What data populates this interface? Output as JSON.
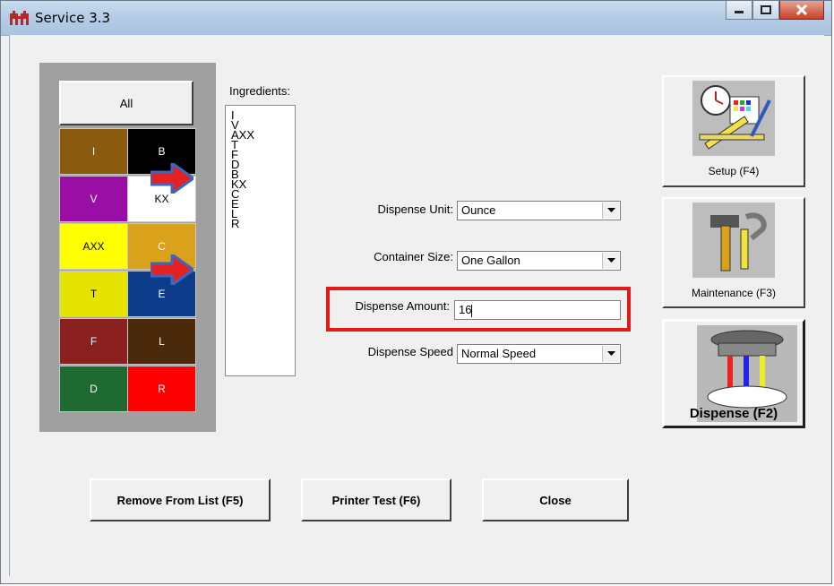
{
  "window": {
    "title": "Service 3.3",
    "controls": [
      "minimize-icon",
      "maximize-icon",
      "close-icon"
    ]
  },
  "palette": {
    "all_label": "All",
    "cells": [
      {
        "label": "I",
        "color": "#8a5a0e",
        "text_color": "#ffffff"
      },
      {
        "label": "B",
        "color": "#000000",
        "text_color": "#ffffff"
      },
      {
        "label": "V",
        "color": "#9a0ea6",
        "text_color": "#ffffff"
      },
      {
        "label": "KX",
        "color": "#ffffff",
        "text_color": "#000000"
      },
      {
        "label": "AXX",
        "color": "#ffff00",
        "text_color": "#000000"
      },
      {
        "label": "C",
        "color": "#d9a21a",
        "text_color": "#ffffff"
      },
      {
        "label": "T",
        "color": "#e4e400",
        "text_color": "#000000"
      },
      {
        "label": "E",
        "color": "#0d3d8a",
        "text_color": "#ffffff"
      },
      {
        "label": "F",
        "color": "#8a2020",
        "text_color": "#ffffff"
      },
      {
        "label": "L",
        "color": "#4a2a0a",
        "text_color": "#ffffff"
      },
      {
        "label": "D",
        "color": "#1e6a30",
        "text_color": "#ffffff"
      },
      {
        "label": "R",
        "color": "#ff0000",
        "text_color": "#ffffff"
      }
    ]
  },
  "ingredients": {
    "label": "Ingredients:",
    "items": [
      "I",
      "V",
      "AXX",
      "T",
      "F",
      "D",
      "B",
      "KX",
      "C",
      "E",
      "L",
      "R"
    ]
  },
  "form": {
    "dispense_unit": {
      "label": "Dispense Unit:",
      "value": "Ounce"
    },
    "container_size": {
      "label": "Container Size:",
      "value": "One Gallon"
    },
    "dispense_amount": {
      "label": "Dispense Amount:",
      "value": "16"
    },
    "dispense_speed": {
      "label": "Dispense Speed",
      "value": "Normal Speed"
    }
  },
  "side_buttons": {
    "setup": "Setup (F4)",
    "maintenance": "Maintenance (F3)",
    "dispense": "Dispense (F2)"
  },
  "bottom_buttons": {
    "remove": "Remove From List (F5)",
    "printer_test": "Printer Test (F6)",
    "close": "Close"
  }
}
